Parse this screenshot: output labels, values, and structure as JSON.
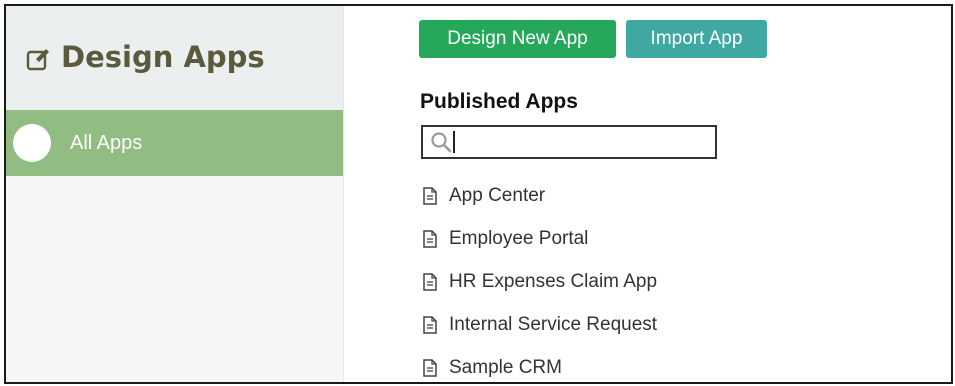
{
  "sidebar": {
    "title": "Design Apps",
    "title_icon": "edit-icon",
    "items": [
      {
        "label": "All Apps",
        "icon": "circle-icon",
        "active": true
      }
    ],
    "colors": {
      "active_bg": "#91bc82",
      "title": "#5b5a3d"
    }
  },
  "toolbar": {
    "design_new_label": "Design New App",
    "import_label": "Import App",
    "colors": {
      "design_new": "#25a85a",
      "import": "#3fa8a2"
    }
  },
  "main": {
    "section_title": "Published Apps",
    "search": {
      "value": "",
      "placeholder": "",
      "icon": "search-icon"
    },
    "apps": [
      {
        "label": "App Center",
        "icon": "document-icon"
      },
      {
        "label": "Employee Portal",
        "icon": "document-icon"
      },
      {
        "label": "HR Expenses Claim App",
        "icon": "document-icon"
      },
      {
        "label": "Internal Service Request",
        "icon": "document-icon"
      },
      {
        "label": "Sample CRM",
        "icon": "document-icon"
      }
    ]
  }
}
